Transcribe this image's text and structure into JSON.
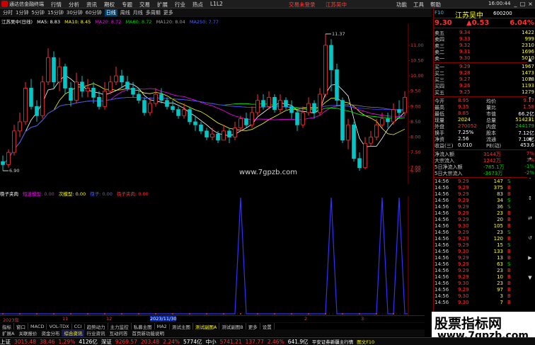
{
  "titlebar": {
    "app_title": "通达信金融终端",
    "menu": [
      "行情",
      "分析",
      "资讯",
      "期权",
      "专题",
      "交易",
      "扩展",
      "行业",
      "热点",
      "L1L2"
    ],
    "alert_trade": "交易未登录",
    "alert_stock": "江苏吴中",
    "right_menu": [
      "功能",
      "工具",
      "帮助"
    ],
    "time": "16:00:44",
    "win_buttons": [
      "_",
      "□",
      "×"
    ]
  },
  "toolbar": {
    "items": [
      "分时",
      "1分钟",
      "5分钟",
      "15分钟",
      "30分钟",
      "60分钟",
      "日线",
      "周线",
      "月线",
      "多周期",
      "更多"
    ],
    "active": "日线"
  },
  "chart_info": {
    "name": "江苏吴中(日线)",
    "ma5": "MA5: 8.83",
    "ma10": "MA10: 8.45",
    "ma20": "MA20: 8.72",
    "ma60": "MA60: 8.72",
    "ma120": "MA120: 8.04",
    "ma250": "MA250: 7.77"
  },
  "indicator_info": {
    "name": "筷子夹肉",
    "v1": "短速模型: 0.00",
    "v2": "次模型: 0.00",
    "v3": "筷子: 0.00",
    "v4": "筷子夹肉: 0.00"
  },
  "colors": {
    "up": "#ff3030",
    "down": "#00c8c8",
    "ma5": "#ffffff",
    "ma10": "#ffff00",
    "ma20": "#ff00ff",
    "ma60": "#00ff00",
    "ma120": "#808080",
    "ma250": "#4040ff",
    "indicator": "#3030ff"
  },
  "chart_data": {
    "type": "candlestick",
    "y_range": [
      6.6,
      11.6
    ],
    "y_ticks": [
      "11.00",
      "10.50",
      "10.00",
      "9.50",
      "9.00",
      "8.50",
      "8.00",
      "7.50",
      "7.00",
      "6.90"
    ],
    "high_mark": "11.37",
    "low_mark": "6.90",
    "x_labels": [
      "2023年",
      "11",
      "12",
      "2023/11/30",
      "2",
      "3"
    ],
    "candles": [
      [
        7.2,
        7.1,
        7.4,
        6.9
      ],
      [
        7.1,
        7.5,
        7.6,
        7.0
      ],
      [
        7.5,
        8.2,
        8.4,
        7.4
      ],
      [
        8.2,
        8.5,
        8.8,
        8.0
      ],
      [
        8.5,
        9.6,
        9.8,
        8.4
      ],
      [
        9.6,
        9.0,
        9.9,
        8.9
      ],
      [
        9.0,
        8.7,
        9.2,
        8.5
      ],
      [
        8.7,
        9.8,
        10.0,
        8.6
      ],
      [
        9.8,
        10.6,
        10.9,
        9.7
      ],
      [
        10.6,
        9.8,
        10.8,
        9.6
      ],
      [
        9.8,
        10.3,
        10.6,
        9.5
      ],
      [
        10.3,
        9.6,
        10.4,
        9.4
      ],
      [
        9.6,
        9.2,
        9.8,
        9.0
      ],
      [
        9.2,
        9.8,
        10.1,
        9.1
      ],
      [
        9.8,
        9.5,
        10.0,
        9.3
      ],
      [
        9.5,
        9.6,
        9.9,
        9.3
      ],
      [
        9.6,
        9.3,
        9.8,
        9.1
      ],
      [
        9.3,
        9.0,
        9.5,
        8.9
      ],
      [
        9.0,
        9.5,
        9.8,
        8.9
      ],
      [
        9.5,
        9.8,
        10.0,
        9.4
      ],
      [
        9.8,
        10.0,
        10.3,
        9.7
      ],
      [
        10.0,
        9.8,
        10.2,
        9.6
      ],
      [
        9.8,
        9.6,
        10.0,
        9.5
      ],
      [
        9.6,
        9.4,
        9.8,
        9.3
      ],
      [
        9.4,
        9.2,
        9.6,
        9.1
      ],
      [
        9.2,
        8.8,
        9.3,
        8.7
      ],
      [
        8.8,
        9.1,
        9.3,
        8.7
      ],
      [
        9.1,
        9.4,
        9.6,
        9.0
      ],
      [
        9.4,
        9.2,
        9.6,
        9.1
      ],
      [
        9.2,
        9.0,
        9.3,
        8.9
      ],
      [
        9.0,
        8.9,
        9.2,
        8.8
      ],
      [
        8.9,
        8.7,
        9.0,
        8.6
      ],
      [
        8.7,
        8.9,
        9.1,
        8.6
      ],
      [
        8.9,
        8.5,
        9.0,
        8.4
      ],
      [
        8.5,
        8.4,
        8.7,
        8.2
      ],
      [
        8.4,
        8.2,
        8.5,
        8.1
      ],
      [
        8.2,
        8.0,
        8.3,
        7.9
      ],
      [
        8.0,
        8.1,
        8.3,
        7.9
      ],
      [
        8.1,
        7.9,
        8.2,
        7.8
      ],
      [
        7.9,
        8.2,
        8.4,
        7.9
      ],
      [
        8.2,
        8.0,
        8.3,
        7.8
      ],
      [
        8.0,
        8.3,
        8.5,
        7.9
      ],
      [
        8.3,
        8.6,
        8.7,
        8.2
      ],
      [
        8.6,
        8.4,
        8.8,
        8.3
      ],
      [
        8.4,
        8.8,
        9.0,
        8.3
      ],
      [
        8.8,
        9.2,
        9.4,
        8.7
      ],
      [
        9.2,
        9.0,
        9.4,
        8.9
      ],
      [
        9.0,
        9.3,
        9.5,
        8.9
      ],
      [
        9.3,
        8.9,
        9.4,
        8.8
      ],
      [
        8.9,
        9.2,
        9.4,
        8.8
      ],
      [
        9.2,
        9.0,
        9.3,
        8.9
      ],
      [
        9.0,
        8.8,
        9.2,
        8.6
      ],
      [
        8.8,
        8.4,
        8.9,
        8.2
      ],
      [
        8.4,
        8.8,
        9.0,
        8.3
      ],
      [
        8.8,
        9.1,
        9.3,
        8.7
      ],
      [
        9.1,
        8.8,
        9.2,
        8.6
      ],
      [
        8.8,
        9.4,
        9.6,
        8.7
      ],
      [
        9.4,
        11.0,
        11.37,
        9.3
      ],
      [
        11.0,
        10.2,
        11.2,
        9.5
      ],
      [
        10.2,
        9.2,
        10.4,
        9.0
      ],
      [
        9.2,
        7.9,
        9.3,
        7.8
      ],
      [
        7.9,
        8.4,
        8.6,
        7.6
      ],
      [
        8.4,
        7.3,
        8.5,
        7.2
      ],
      [
        7.3,
        7.0,
        7.5,
        6.9
      ],
      [
        7.0,
        7.8,
        8.0,
        6.95
      ],
      [
        7.8,
        8.0,
        8.2,
        7.7
      ],
      [
        8.0,
        8.4,
        8.6,
        7.9
      ],
      [
        8.4,
        8.6,
        8.8,
        8.3
      ],
      [
        8.6,
        8.5,
        8.8,
        8.3
      ],
      [
        8.5,
        8.9,
        9.1,
        8.4
      ],
      [
        8.9,
        8.8,
        9.2,
        8.6
      ],
      [
        8.8,
        9.3,
        9.5,
        8.7
      ]
    ],
    "indicator_peaks": [
      42,
      58,
      67,
      70
    ]
  },
  "right_panel": {
    "flag": "F10",
    "name": "江苏吴中",
    "code": "600200",
    "price": "9.30",
    "change": "▲0.53",
    "pct": "6.04%",
    "asks": [
      {
        "label": "卖五",
        "price": "9.34",
        "vol": "1422"
      },
      {
        "label": "卖四",
        "price": "9.33",
        "vol": "999"
      },
      {
        "label": "卖三",
        "price": "9.32",
        "vol": "2310"
      },
      {
        "label": "卖二",
        "price": "9.31",
        "vol": "1696"
      },
      {
        "label": "卖一",
        "price": "9.30",
        "vol": "5010"
      }
    ],
    "bids": [
      {
        "label": "买一",
        "price": "9.29",
        "vol": "1967"
      },
      {
        "label": "买二",
        "price": "9.28",
        "vol": "1473"
      },
      {
        "label": "买三",
        "price": "9.27",
        "vol": "1078"
      },
      {
        "label": "买四",
        "price": "9.26",
        "vol": "1193"
      },
      {
        "label": "买五",
        "price": "9.25",
        "vol": "1279"
      }
    ],
    "stats": [
      {
        "k": "今开",
        "v": "8.95",
        "vc": "red",
        "k2": "均价",
        "v2": "9.17",
        "v2c": "red"
      },
      {
        "k": "最高",
        "v": "9.35",
        "vc": "red",
        "k2": "量比",
        "v2": "1.58",
        "v2c": "red"
      },
      {
        "k": "最低",
        "v": "8.85",
        "vc": "red",
        "k2": "市值",
        "v2": "66.2亿",
        "v2c": "white"
      },
      {
        "k": "现量",
        "v": "2024",
        "vc": "yellow",
        "k2": "总量",
        "v2": "514231",
        "v2c": "yellow"
      },
      {
        "k": "外盘",
        "v": "270052",
        "vc": "red",
        "k2": "内盘",
        "v2": "244179",
        "v2c": "green"
      },
      {
        "k": "换手",
        "v": "7.25%",
        "vc": "white",
        "k2": "股本",
        "v2": "7.12亿",
        "v2c": "white"
      },
      {
        "k": "净资",
        "v": "2.56",
        "vc": "white",
        "k2": "流通",
        "v2": "7.10亿",
        "v2c": "white"
      },
      {
        "k": "收益(三)",
        "v": "0.010",
        "vc": "white",
        "k2": "PE(动)",
        "v2": "453.6",
        "v2c": "white"
      }
    ],
    "flows": [
      {
        "k": "净流入额",
        "v": "3144万",
        "p": "7%",
        "c": "red"
      },
      {
        "k": "大宗流入",
        "v": "1242万",
        "p": "3%",
        "c": "red"
      },
      {
        "k": "5日净流入额",
        "v": "-785.1万",
        "p": "-1%",
        "c": "green"
      },
      {
        "k": "5日大宗流入",
        "v": "-3673万",
        "p": "-2%",
        "c": "green"
      }
    ],
    "ticks": [
      {
        "t": "14:56",
        "p": "9.29",
        "q": "147",
        "d": "S"
      },
      {
        "t": "14:56",
        "p": "9.29",
        "q": "375",
        "d": "B"
      },
      {
        "t": "14:56",
        "p": "9.29",
        "q": "83",
        "d": "B"
      },
      {
        "t": "14:56",
        "p": "9.29",
        "q": "34",
        "d": "S"
      },
      {
        "t": "14:56",
        "p": "9.29",
        "q": "36",
        "d": "S"
      },
      {
        "t": "14:56",
        "p": "9.29",
        "q": "23",
        "d": "B"
      },
      {
        "t": "14:56",
        "p": "9.29",
        "q": "20",
        "d": "B"
      },
      {
        "t": "14:56",
        "p": "9.30",
        "q": "105",
        "d": "B"
      },
      {
        "t": "14:56",
        "p": "9.29",
        "q": "23",
        "d": "S"
      },
      {
        "t": "14:56",
        "p": "9.29",
        "q": "120",
        "d": "B"
      },
      {
        "t": "14:56",
        "p": "9.29",
        "q": "15",
        "d": "S"
      },
      {
        "t": "14:56",
        "p": "9.30",
        "q": "133",
        "d": "B"
      },
      {
        "t": "14:56",
        "p": "9.29",
        "q": "13",
        "d": "B"
      },
      {
        "t": "14:56",
        "p": "9.29",
        "q": "63",
        "d": "S"
      },
      {
        "t": "14:56",
        "p": "9.29",
        "q": "23",
        "d": "B"
      },
      {
        "t": "14:56",
        "p": "9.29",
        "q": "10",
        "d": "B"
      },
      {
        "t": "14:56",
        "p": "9.30",
        "q": "23",
        "d": "B"
      },
      {
        "t": "14:56",
        "p": "9.29",
        "q": "97",
        "d": "B"
      },
      {
        "t": "14:56",
        "p": "9.30",
        "q": "3",
        "d": "B"
      },
      {
        "t": "14:56",
        "p": "9.30",
        "q": "7",
        "d": "B"
      }
    ]
  },
  "tabs_row1": {
    "items": [
      "指标",
      "窗口",
      "MACD",
      "VOL-TDX",
      "CCI",
      "趋势动力",
      "主力监控",
      "私募主图",
      "MA2",
      "测试主图",
      "测试副图A",
      "测试副图B",
      "更多",
      "设置"
    ],
    "active": "测试副图A"
  },
  "tabs_row2": {
    "items": [
      "扩展A",
      "关联报价",
      "资金分布",
      "综合资讯",
      "行业资讯",
      "互动问答",
      "首页新功能说明"
    ],
    "active": "综合资讯"
  },
  "status": {
    "sh_label": "上证",
    "sh_val": "3015.48",
    "sh_chg": "38.46",
    "sh_pct": "1.29%",
    "sh_amt": "4126亿",
    "sz_label": "深证",
    "sz_val": "9269.57",
    "sz_chg": "203.48",
    "sz_pct": "2.24%",
    "sz_amt": "5774亿",
    "zx_label": "中小",
    "zx_val": "5741.21",
    "zx_chg": "137.77",
    "zx_pct": "2.46%",
    "zx_amt": "641.9亿",
    "broker": "平安证券新疆主行情",
    "right": "图文F10"
  },
  "watermarks": {
    "center": "www.7gpzb.com",
    "corner_l1": "股票指标网",
    "corner_l2": "www.7gpzb.com"
  },
  "scroll_icons": [
    "▲",
    "≡",
    "↑",
    "↓",
    "◆",
    "+",
    "-",
    "↕",
    "⇄",
    "↺",
    "▶",
    "▼"
  ]
}
